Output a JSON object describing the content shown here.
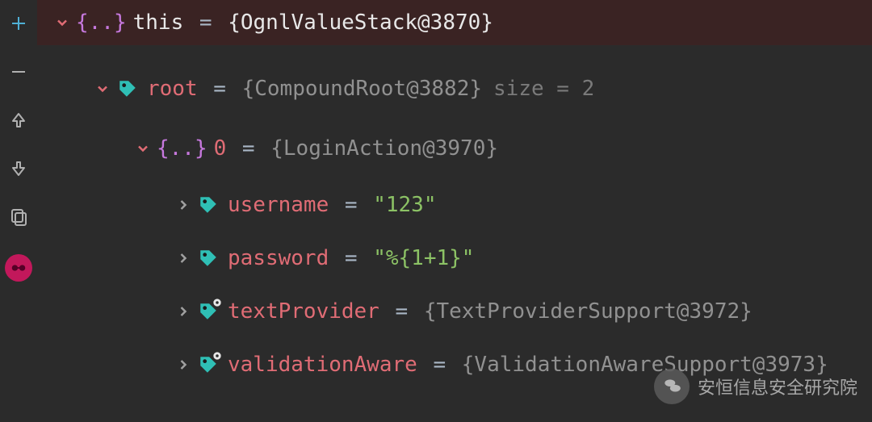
{
  "gutter": {
    "add": "add",
    "remove": "remove",
    "up": "up",
    "down": "down",
    "copy": "copy",
    "avatar": "glasses"
  },
  "tree": {
    "this": {
      "name": "this",
      "value": "{OgnlValueStack@3870}"
    },
    "root": {
      "name": "root",
      "value": "{CompoundRoot@3882}",
      "sizeLabel": "size = 2"
    },
    "zero": {
      "name": "0",
      "value": "{LoginAction@3970}"
    },
    "username": {
      "name": "username",
      "value": "\"123\""
    },
    "password": {
      "name": "password",
      "value": "\"%{1+1}\""
    },
    "textProvider": {
      "name": "textProvider",
      "value": "{TextProviderSupport@3972}"
    },
    "validationAware": {
      "name": "validationAware",
      "value": "{ValidationAwareSupport@3973}"
    }
  },
  "watermark": {
    "text": "安恒信息安全研究院"
  }
}
